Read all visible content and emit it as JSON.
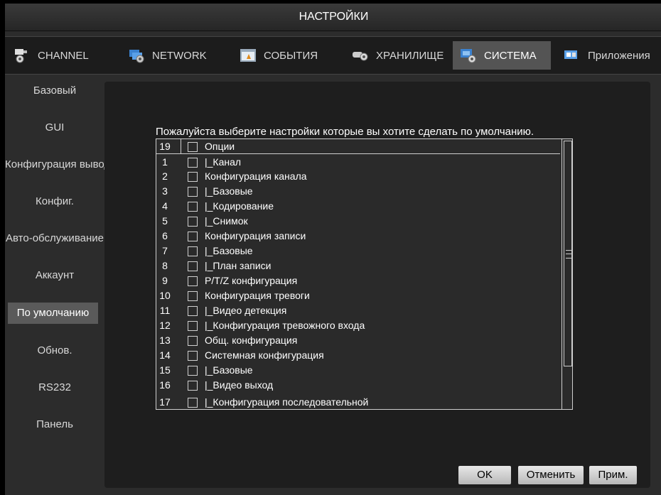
{
  "window": {
    "title": "НАСТРОЙКИ"
  },
  "tabs": [
    {
      "label": "CHANNEL",
      "icon": "camera-icon"
    },
    {
      "label": "NETWORK",
      "icon": "network-icon"
    },
    {
      "label": "СОБЫТИЯ",
      "icon": "events-icon"
    },
    {
      "label": "ХРАНИЛИЩЕ",
      "icon": "storage-icon"
    },
    {
      "label": "СИСТЕМА",
      "icon": "system-icon",
      "active": true
    },
    {
      "label": "Приложения",
      "icon": "apps-icon"
    }
  ],
  "sidebar": {
    "items": [
      {
        "label": "Базовый"
      },
      {
        "label": "GUI"
      },
      {
        "label": "Конфигурация вывода"
      },
      {
        "label": "Конфиг."
      },
      {
        "label": "Авто-обслуживание"
      },
      {
        "label": "Аккаунт"
      },
      {
        "label": "По умолчанию",
        "active": true
      },
      {
        "label": "Обнов."
      },
      {
        "label": "RS232"
      },
      {
        "label": "Панель"
      }
    ]
  },
  "main": {
    "prompt": "Пожалуйста выберите настройки которые вы хотите сделать по умолчанию.",
    "list": {
      "header": {
        "count": "19",
        "label": "Опции"
      },
      "rows": [
        {
          "num": "1",
          "label": "|_Канал"
        },
        {
          "num": "2",
          "label": "Конфигурация канала"
        },
        {
          "num": "3",
          "label": "|_Базовые"
        },
        {
          "num": "4",
          "label": "|_Кодирование"
        },
        {
          "num": "5",
          "label": "|_Снимок"
        },
        {
          "num": "6",
          "label": "Конфигурация записи"
        },
        {
          "num": "7",
          "label": "|_Базовые"
        },
        {
          "num": "8",
          "label": "|_План записи"
        },
        {
          "num": "9",
          "label": "P/T/Z конфигурация"
        },
        {
          "num": "10",
          "label": "Конфигурация тревоги"
        },
        {
          "num": "11",
          "label": "|_Видео детекция"
        },
        {
          "num": "12",
          "label": "|_Конфигурация тревожного входа"
        },
        {
          "num": "13",
          "label": "Общ. конфигурация"
        },
        {
          "num": "14",
          "label": "Системная конфигурация"
        },
        {
          "num": "15",
          "label": "|_Базовые"
        },
        {
          "num": "16",
          "label": "|_Видео выход"
        },
        {
          "num": "17",
          "label": "|_Конфигурация последовательной"
        }
      ]
    }
  },
  "buttons": {
    "ok": "OK",
    "cancel": "Отменить",
    "apply": "Прим."
  },
  "colors": {
    "background": "#2c2c2c",
    "panel": "#1e1e1e",
    "active_tab": "#545454",
    "active_item": "#5a5a5a"
  }
}
